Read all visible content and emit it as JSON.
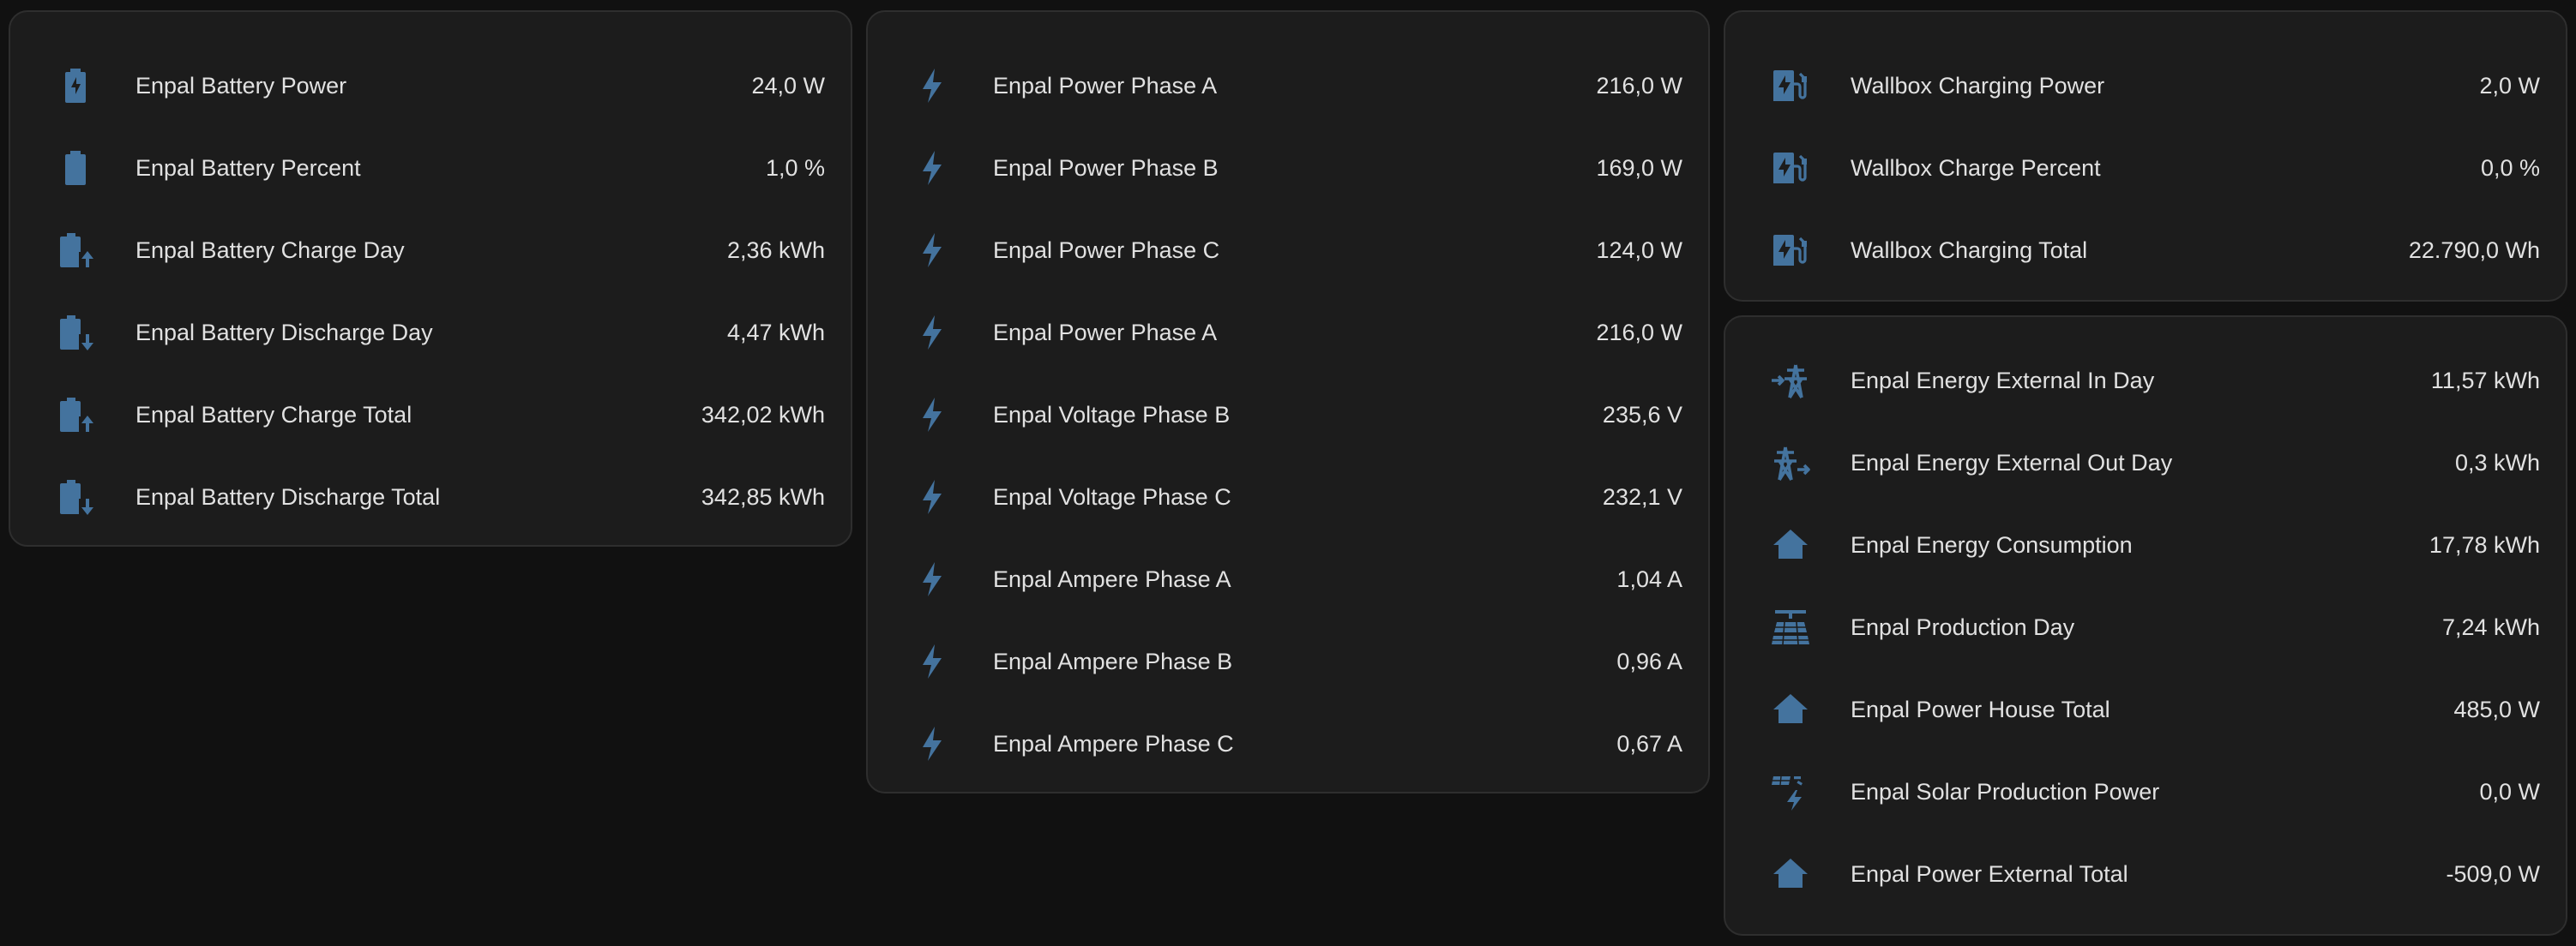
{
  "colors": {
    "background": "#111111",
    "card": "#1c1c1c",
    "card_border": "#2e2e2e",
    "icon": "#44739e",
    "text": "#e1e1e1"
  },
  "battery_card": {
    "rows": [
      {
        "icon": "battery-charging-icon",
        "label": "Enpal Battery Power",
        "value": "24,0 W"
      },
      {
        "icon": "battery-icon",
        "label": "Enpal Battery Percent",
        "value": "1,0 %"
      },
      {
        "icon": "battery-arrow-up-icon",
        "label": "Enpal Battery Charge Day",
        "value": "2,36 kWh"
      },
      {
        "icon": "battery-arrow-down-icon",
        "label": "Enpal Battery Discharge Day",
        "value": "4,47 kWh"
      },
      {
        "icon": "battery-arrow-up-icon",
        "label": "Enpal Battery Charge Total",
        "value": "342,02 kWh"
      },
      {
        "icon": "battery-arrow-down-icon",
        "label": "Enpal Battery Discharge Total",
        "value": "342,85 kWh"
      }
    ]
  },
  "phase_card": {
    "rows": [
      {
        "icon": "flash-icon",
        "label": "Enpal Power Phase A",
        "value": "216,0 W"
      },
      {
        "icon": "flash-icon",
        "label": "Enpal Power Phase B",
        "value": "169,0 W"
      },
      {
        "icon": "flash-icon",
        "label": "Enpal Power Phase C",
        "value": "124,0 W"
      },
      {
        "icon": "flash-icon",
        "label": "Enpal Power Phase A",
        "value": "216,0 W"
      },
      {
        "icon": "flash-icon",
        "label": "Enpal Voltage Phase B",
        "value": "235,6 V"
      },
      {
        "icon": "flash-icon",
        "label": "Enpal Voltage Phase C",
        "value": "232,1 V"
      },
      {
        "icon": "flash-icon",
        "label": "Enpal Ampere Phase A",
        "value": "1,04 A"
      },
      {
        "icon": "flash-icon",
        "label": "Enpal Ampere Phase B",
        "value": "0,96 A"
      },
      {
        "icon": "flash-icon",
        "label": "Enpal Ampere Phase C",
        "value": "0,67 A"
      }
    ]
  },
  "wallbox_card": {
    "rows": [
      {
        "icon": "ev-station-icon",
        "label": "Wallbox Charging Power",
        "value": "2,0 W"
      },
      {
        "icon": "ev-station-icon",
        "label": "Wallbox Charge Percent",
        "value": "0,0 %"
      },
      {
        "icon": "ev-station-icon",
        "label": "Wallbox Charging Total",
        "value": "22.790,0 Wh"
      }
    ]
  },
  "energy_card": {
    "rows": [
      {
        "icon": "transmission-tower-import-icon",
        "label": "Enpal Energy External In Day",
        "value": "11,57 kWh"
      },
      {
        "icon": "transmission-tower-export-icon",
        "label": "Enpal Energy External Out Day",
        "value": "0,3 kWh"
      },
      {
        "icon": "home-lightning-icon",
        "label": "Enpal Energy Consumption",
        "value": "17,78 kWh"
      },
      {
        "icon": "solar-panel-icon",
        "label": "Enpal Production Day",
        "value": "7,24 kWh"
      },
      {
        "icon": "home-lightning-icon",
        "label": "Enpal Power House Total",
        "value": "485,0 W"
      },
      {
        "icon": "solar-power-icon",
        "label": "Enpal Solar Production Power",
        "value": "0,0 W"
      },
      {
        "icon": "home-lightning-icon",
        "label": "Enpal Power External Total",
        "value": "-509,0 W"
      }
    ]
  }
}
